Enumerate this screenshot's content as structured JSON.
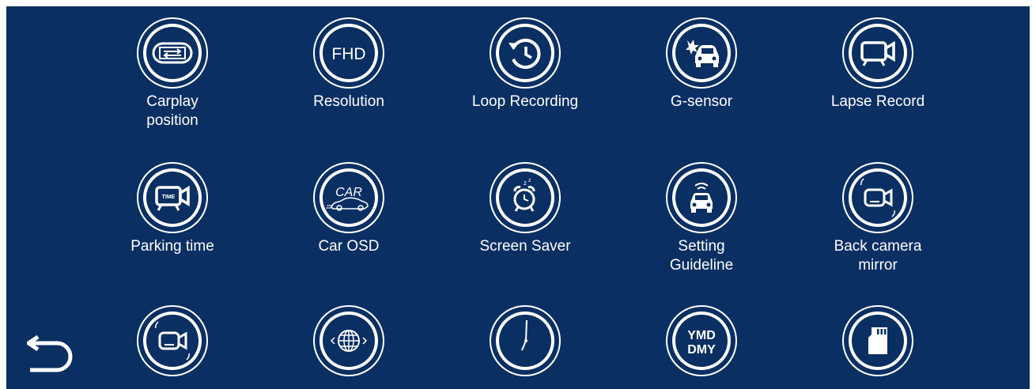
{
  "menu": {
    "items": [
      {
        "label": "Carplay\nposition",
        "icon": "carplay-position-icon"
      },
      {
        "label": "Resolution",
        "icon": "fhd-icon",
        "icon_text": "FHD"
      },
      {
        "label": "Loop Recording",
        "icon": "loop-recording-icon"
      },
      {
        "label": "G-sensor",
        "icon": "g-sensor-icon"
      },
      {
        "label": "Lapse Record",
        "icon": "lapse-record-icon"
      },
      {
        "label": "Parking time",
        "icon": "parking-time-icon",
        "icon_text": "TIME"
      },
      {
        "label": "Car OSD",
        "icon": "car-osd-icon",
        "icon_text": "CAR"
      },
      {
        "label": "Screen Saver",
        "icon": "alarm-clock-icon"
      },
      {
        "label": "Setting\nGuideline",
        "icon": "guideline-icon"
      },
      {
        "label": "Back camera\nmirror",
        "icon": "back-camera-mirror-icon"
      },
      {
        "label": "",
        "icon": "camera-mirror-icon"
      },
      {
        "label": "",
        "icon": "globe-language-icon"
      },
      {
        "label": "",
        "icon": "clock-icon"
      },
      {
        "label": "",
        "icon": "date-format-icon",
        "icon_text": "YMD",
        "icon_text2": "DMY"
      },
      {
        "label": "",
        "icon": "sd-card-icon"
      }
    ]
  },
  "back_button": {
    "icon": "back-arrow-icon"
  },
  "colors": {
    "background": "#0a2f63",
    "foreground": "#ffffff"
  }
}
